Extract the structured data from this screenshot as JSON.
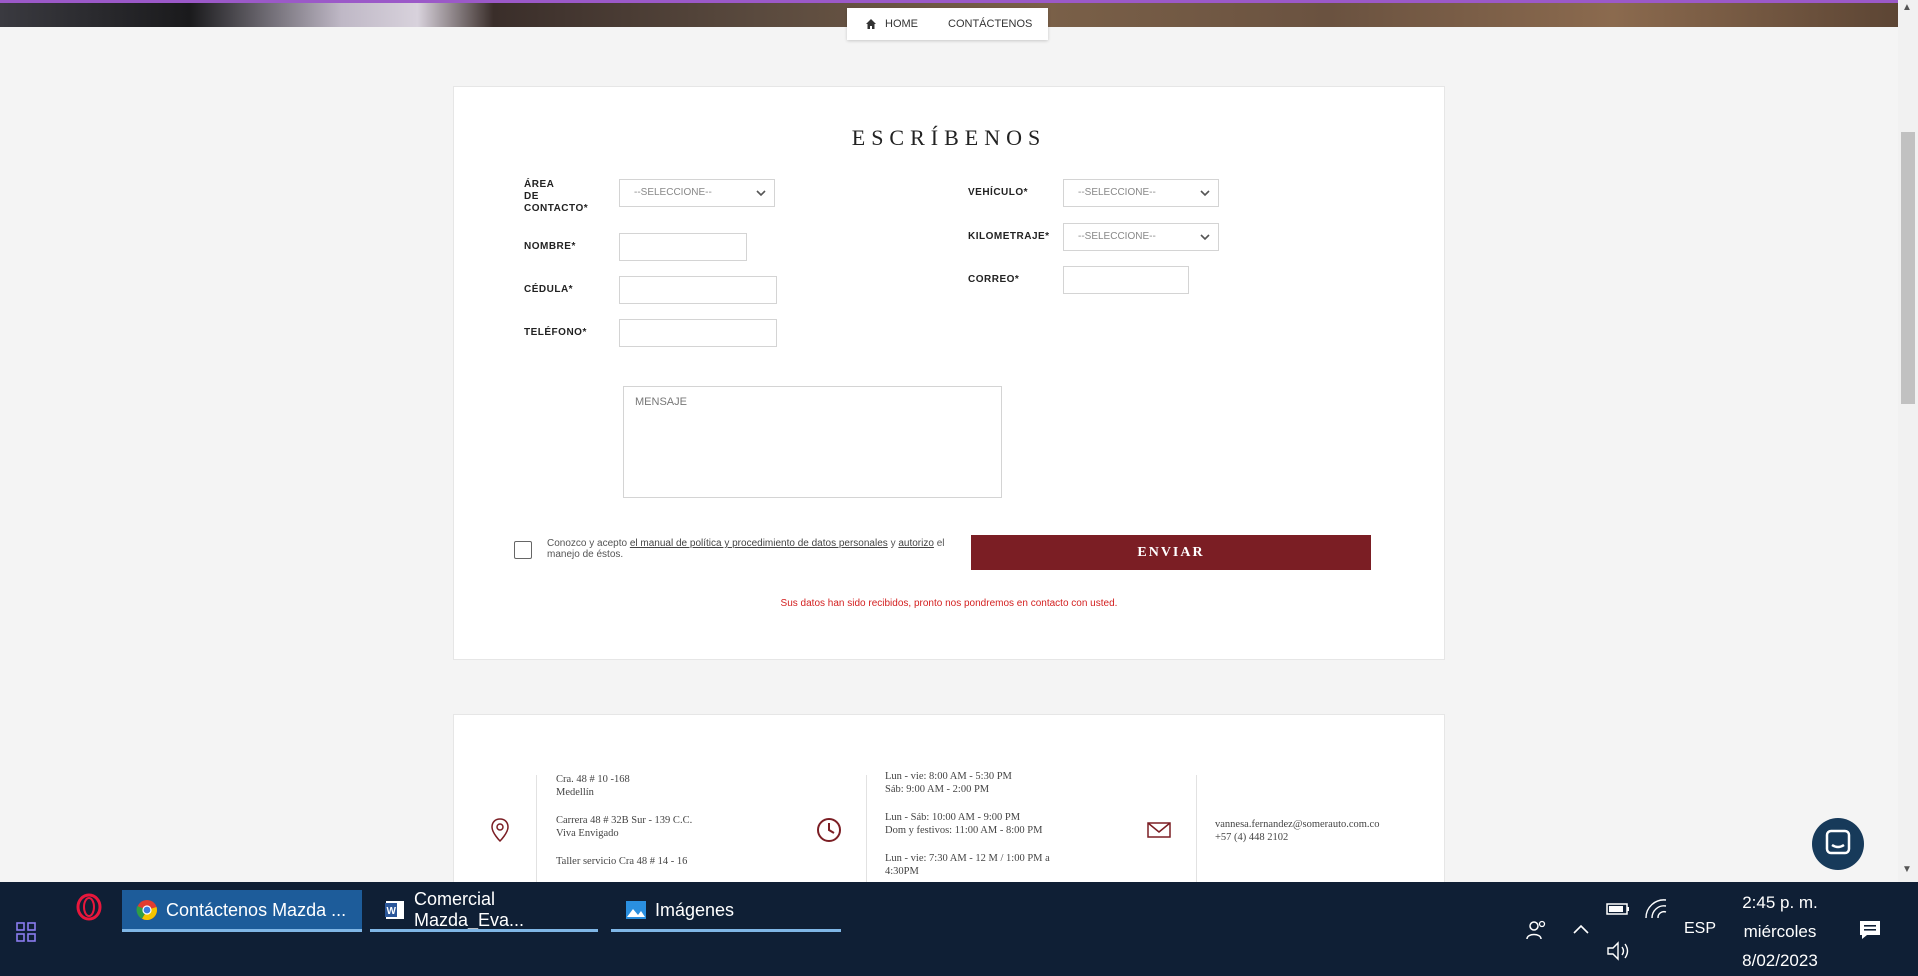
{
  "breadcrumb": {
    "home": "HOME",
    "current": "CONTÁCTENOS"
  },
  "form": {
    "title": "ESCRÍBENOS",
    "area_label_lines": [
      "ÁREA",
      "DE",
      "CONTACTO*"
    ],
    "area_value": "--SELECCIONE--",
    "nombre_label": "NOMBRE*",
    "cedula_label": "CÉDULA*",
    "telefono_label": "TELÉFONO*",
    "vehiculo_label": "VEHÍCULO*",
    "vehiculo_value": "--SELECCIONE--",
    "kilometraje_label": "KILOMETRAJE*",
    "kilometraje_value": "--SELECCIONE--",
    "correo_label": "CORREO*",
    "mensaje_placeholder": "MENSAJE",
    "consent_prefix": "Conozco y acepto",
    "consent_link1": "el manual de política y procedimiento de datos personales",
    "consent_mid": "y",
    "consent_link2": "autorizo",
    "consent_suffix": "el manejo de éstos.",
    "submit": "ENVIAR",
    "success": "Sus datos han sido recibidos, pronto nos pondremos en contacto con usted."
  },
  "info": {
    "addresses": [
      "Cra. 48 # 10 -168",
      "Medellín",
      "Carrera 48 # 32B Sur - 139 C.C.",
      "Viva Envigado",
      "Taller servicio Cra 48 # 14 - 16"
    ],
    "hours": [
      "Lun - vie: 8:00 AM - 5:30 PM",
      "Sáb: 9:00 AM - 2:00 PM",
      "Lun - Sáb: 10:00 AM - 9:00 PM",
      "Dom y festivos: 11:00 AM - 8:00 PM",
      "Lun - vie: 7:30 AM - 12 M / 1:00 PM a",
      "4:30PM"
    ],
    "email": "vannesa.fernandez@somerauto.com.co",
    "phone": "+57 (4) 448 2102"
  },
  "taskbar": {
    "items": [
      {
        "label": "Contáctenos Mazda ...",
        "icon": "chrome-icon"
      },
      {
        "label": "Comercial Mazda_Eva...",
        "icon": "word-icon"
      },
      {
        "label": "Imágenes",
        "icon": "photos-icon"
      }
    ],
    "language": "ESP",
    "time": "2:45 p. m.",
    "day": "miércoles",
    "date": "8/02/2023"
  },
  "colors": {
    "accent": "#7b1e24",
    "success_text": "#d31f1f",
    "taskbar_bg": "#0f1f35",
    "taskbar_active": "#1d5c9a"
  }
}
